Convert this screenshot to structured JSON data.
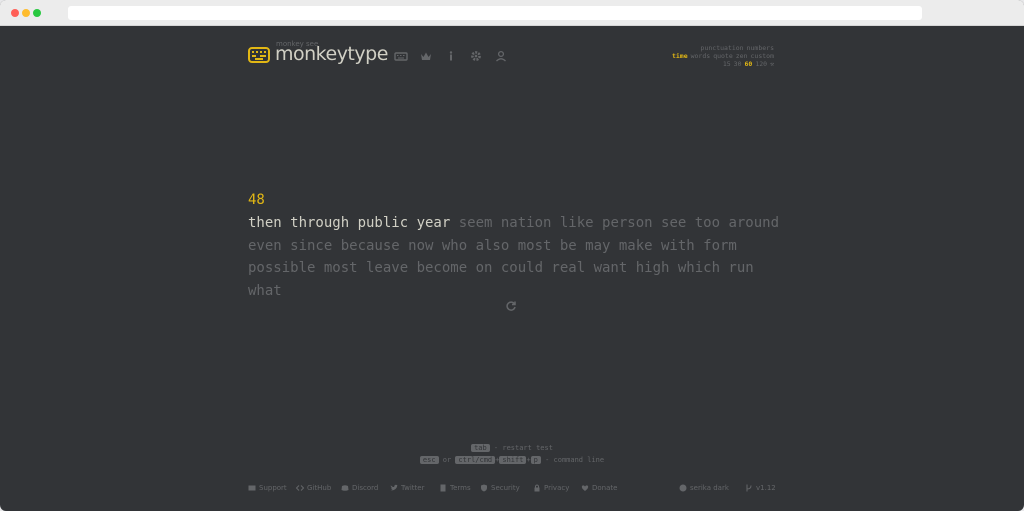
{
  "header": {
    "logo_small": "monkey see",
    "logo_text": "monkeytype"
  },
  "icons": {
    "nav": [
      "keyboard-icon",
      "crown-icon",
      "info-icon",
      "gear-icon",
      "user-icon"
    ]
  },
  "config": {
    "row1": [
      "punctuation",
      "numbers"
    ],
    "row2": [
      "time",
      "words",
      "quote",
      "zen",
      "custom"
    ],
    "row2_active": "time",
    "row3": [
      "15",
      "30",
      "60",
      "120"
    ],
    "row3_active": "60"
  },
  "test": {
    "counter": "48",
    "typed_words": "then through public year",
    "line1_rest": " seem nation like person see too around",
    "line2": "even since because now who also most be may make with form",
    "line3": "possible most leave become on could real want high which run what"
  },
  "hints": {
    "line1_key": "tab",
    "line1_text": " - restart test",
    "line2_key1": "esc",
    "line2_or": " or ",
    "line2_key2": "ctrl/cmd",
    "line2_plus1": "+",
    "line2_key3": "shift",
    "line2_plus2": "+",
    "line2_key4": "p",
    "line2_text": " - command line"
  },
  "footer": {
    "links": [
      "Support",
      "GitHub",
      "Discord",
      "Twitter",
      "Terms",
      "Security",
      "Privacy",
      "Donate"
    ],
    "theme": "serika dark",
    "version": "v1.12"
  },
  "colors": {
    "background": "#323437",
    "accent": "#e2b714",
    "text": "#d1d0c5",
    "sub": "#646669"
  }
}
